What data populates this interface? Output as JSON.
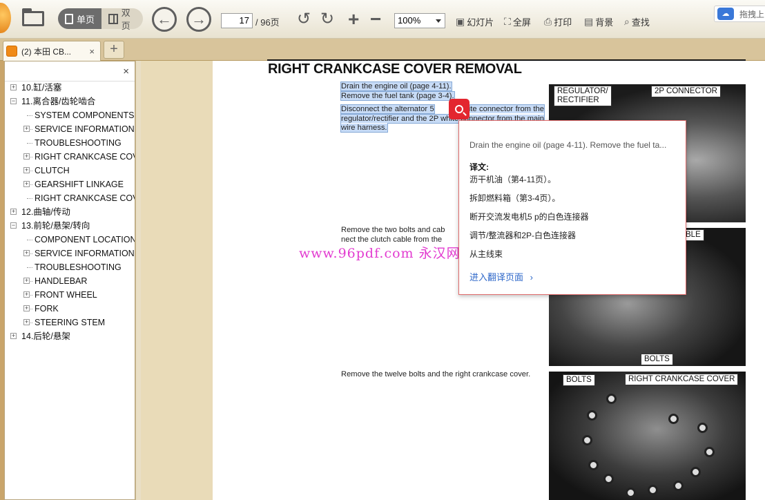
{
  "toolbar": {
    "single_page_label": "单页",
    "double_page_label": "双页",
    "page_current": "17",
    "page_total": "/ 96页",
    "zoom": "100%",
    "slideshow_label": "幻灯片",
    "fullscreen_label": "全屏",
    "print_label": "打印",
    "background_label": "背景",
    "find_label": "查找",
    "drag_tip": "拖拽上"
  },
  "tabs": {
    "doc_tab_label": "(2) 本田 CB...",
    "close_symbol": "×",
    "new_tab_symbol": "+"
  },
  "sidebar": {
    "close_symbol": "×",
    "items": [
      {
        "label": "10.缸/活塞",
        "level": 0,
        "expander": "+"
      },
      {
        "label": "11.离合器/齿轮啮合",
        "level": 0,
        "expander": "−"
      },
      {
        "label": "SYSTEM COMPONENTS",
        "level": 1,
        "expander": ""
      },
      {
        "label": "SERVICE INFORMATION",
        "level": 1,
        "expander": "+"
      },
      {
        "label": "TROUBLESHOOTING",
        "level": 1,
        "expander": ""
      },
      {
        "label": "RIGHT CRANKCASE COVER",
        "level": 1,
        "expander": "+"
      },
      {
        "label": "CLUTCH",
        "level": 1,
        "expander": "+"
      },
      {
        "label": "GEARSHIFT LINKAGE",
        "level": 1,
        "expander": "+"
      },
      {
        "label": "RIGHT CRANKCASE COVER",
        "level": 1,
        "expander": ""
      },
      {
        "label": "12.曲轴/传动",
        "level": 0,
        "expander": "+"
      },
      {
        "label": "13.前轮/悬架/转向",
        "level": 0,
        "expander": "−"
      },
      {
        "label": "COMPONENT LOCATION",
        "level": 1,
        "expander": ""
      },
      {
        "label": "SERVICE INFORMATION",
        "level": 1,
        "expander": "+"
      },
      {
        "label": "TROUBLESHOOTING",
        "level": 1,
        "expander": ""
      },
      {
        "label": "HANDLEBAR",
        "level": 1,
        "expander": "+"
      },
      {
        "label": "FRONT WHEEL",
        "level": 1,
        "expander": "+"
      },
      {
        "label": "FORK",
        "level": 1,
        "expander": "+"
      },
      {
        "label": "STEERING STEM",
        "level": 1,
        "expander": "+"
      },
      {
        "label": "14.后轮/悬架",
        "level": 0,
        "expander": "+"
      }
    ]
  },
  "document": {
    "title": "RIGHT CRANKCASE COVER REMOVAL",
    "para1_line1": "Drain the engine oil (page 4-11).",
    "para1_line2": "Remove the fuel tank (page 3-4).",
    "para2_a": "Disconnect the alternator 5",
    "para2_b": "ite connector from the regulator/rectifier and the 2P white connector from the main wire harness.",
    "para3": "Remove the two bolts and cab",
    "para3_b": "nect the clutch cable from the",
    "para4": "Remove the twelve bolts and the right crankcase cover.",
    "callout_regulator": "REGULATOR/\nRECTIFIER",
    "callout_2p": "2P CONNECTOR",
    "callout_cable": "BLE",
    "callout_bolts_1": "BOLTS",
    "callout_bolts_2": "BOLTS",
    "callout_rcc": "RIGHT CRANKCASE COVER",
    "watermark": "www.96pdf.com 永汉网"
  },
  "popup": {
    "source": "Drain the engine oil (page 4-11). Remove the fuel ta...",
    "translation_label": "译文:",
    "lines": [
      "沥干机油（第4-11页）。",
      "拆卸燃料箱（第3-4页）。",
      "断开交流发电机5 p的白色连接器",
      "调节/整流器和2P-白色连接器",
      "从主线束"
    ],
    "more_label": "进入翻译页面",
    "more_arrow": "›"
  }
}
